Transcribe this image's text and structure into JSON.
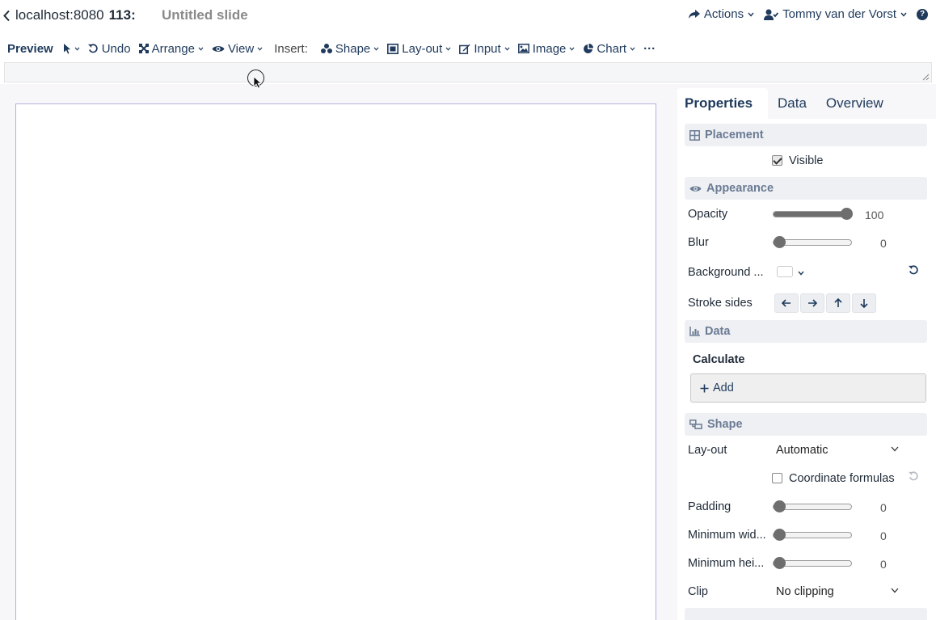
{
  "header": {
    "host": "localhost:8080",
    "doc_number": "113:",
    "doc_title": "Untitled slide",
    "actions_label": "Actions",
    "user_name": "Tommy van der Vorst",
    "help_label": "?"
  },
  "toolbar": {
    "preview_label": "Preview",
    "undo_label": "Undo",
    "arrange_label": "Arrange",
    "view_label": "View",
    "insert_label": "Insert:",
    "shape_label": "Shape",
    "layout_label": "Lay-out",
    "input_label": "Input",
    "image_label": "Image",
    "chart_label": "Chart",
    "more_label": "···"
  },
  "panel": {
    "tabs": [
      "Properties",
      "Data",
      "Overview"
    ],
    "active_tab": "Properties",
    "placement": {
      "title": "Placement",
      "visible_label": "Visible",
      "visible_checked": true
    },
    "appearance": {
      "title": "Appearance",
      "opacity_label": "Opacity",
      "opacity_value": "100",
      "opacity_fraction": 1.0,
      "blur_label": "Blur",
      "blur_value": "0",
      "blur_fraction": 0,
      "background_label": "Background ...",
      "background_color": "#ffffff",
      "stroke_sides_label": "Stroke sides"
    },
    "data": {
      "title": "Data",
      "calculate_label": "Calculate",
      "add_label": "Add"
    },
    "shape": {
      "title": "Shape",
      "layout_label": "Lay-out",
      "layout_value": "Automatic",
      "coord_formulas_label": "Coordinate formulas",
      "coord_formulas_checked": false,
      "padding_label": "Padding",
      "padding_value": "0",
      "padding_fraction": 0,
      "min_width_label": "Minimum wid...",
      "min_width_value": "0",
      "min_width_fraction": 0,
      "min_height_label": "Minimum hei...",
      "min_height_value": "0",
      "min_height_fraction": 0,
      "clip_label": "Clip",
      "clip_value": "No clipping"
    }
  },
  "colors": {
    "accent": "#1f3a5c",
    "section_text": "#6b7b94",
    "slide_border": "#b9aee0"
  }
}
